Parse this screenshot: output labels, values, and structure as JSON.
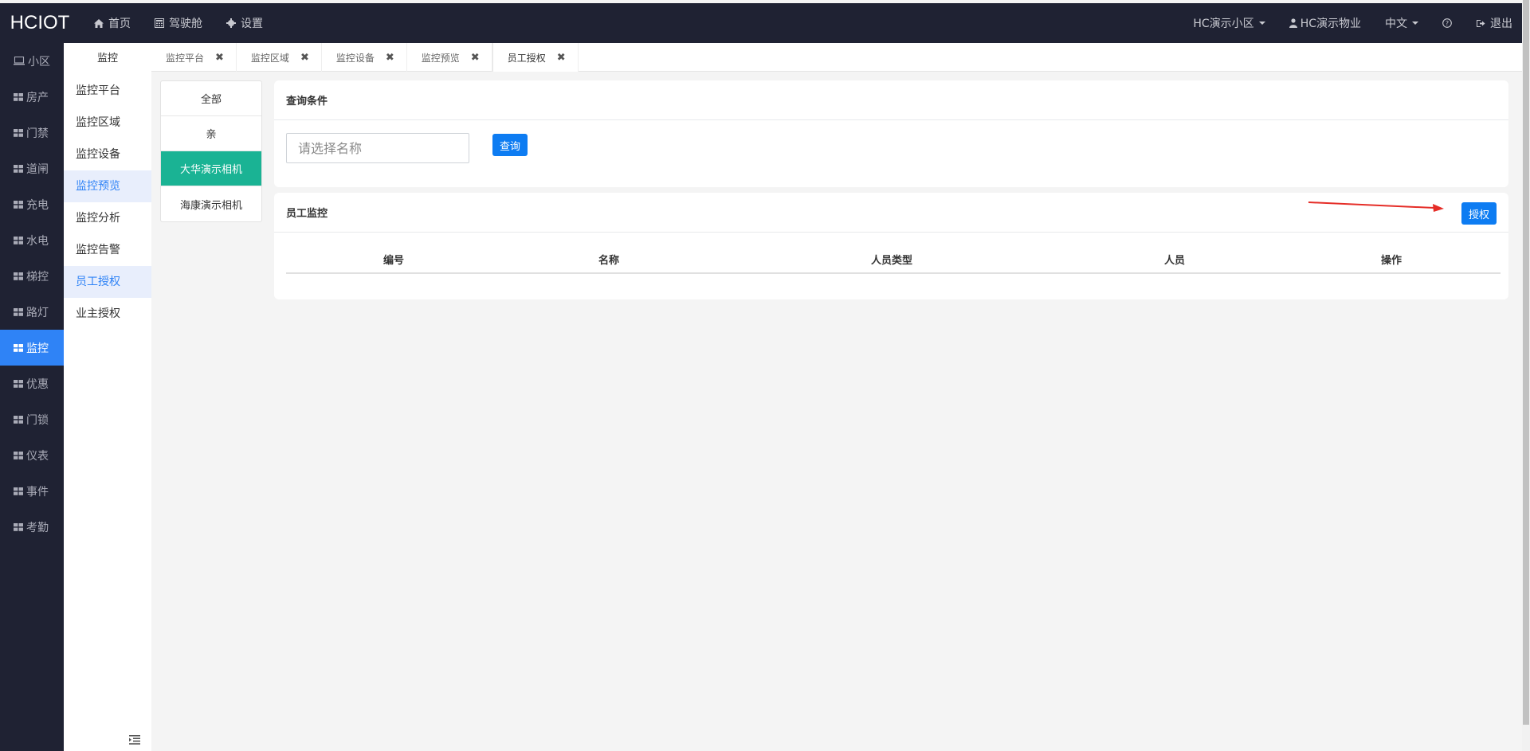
{
  "app": {
    "logo": "HCIOT"
  },
  "topnav": [
    {
      "label": "首页",
      "icon": "home-icon"
    },
    {
      "label": "驾驶舱",
      "icon": "calculator-icon"
    },
    {
      "label": "设置",
      "icon": "gear-icon"
    }
  ],
  "topright": {
    "community": "HC演示小区",
    "property": "HC演示物业",
    "language": "中文",
    "logout": "退出"
  },
  "sidebar": [
    {
      "label": "小区",
      "icon": "monitor-icon"
    },
    {
      "label": "房产",
      "icon": "grid-icon"
    },
    {
      "label": "门禁",
      "icon": "grid-icon"
    },
    {
      "label": "道闸",
      "icon": "grid-icon"
    },
    {
      "label": "充电",
      "icon": "grid-icon"
    },
    {
      "label": "水电",
      "icon": "grid-icon"
    },
    {
      "label": "梯控",
      "icon": "grid-icon"
    },
    {
      "label": "路灯",
      "icon": "grid-icon"
    },
    {
      "label": "监控",
      "icon": "grid-icon",
      "active": true
    },
    {
      "label": "优惠",
      "icon": "grid-icon"
    },
    {
      "label": "门锁",
      "icon": "grid-icon"
    },
    {
      "label": "仪表",
      "icon": "grid-icon"
    },
    {
      "label": "事件",
      "icon": "grid-icon"
    },
    {
      "label": "考勤",
      "icon": "grid-icon"
    }
  ],
  "submenu": {
    "title": "监控",
    "items": [
      "监控平台",
      "监控区域",
      "监控设备",
      "监控预览",
      "监控分析",
      "监控告警",
      "员工授权",
      "业主授权"
    ]
  },
  "tabs": [
    "监控平台",
    "监控区域",
    "监控设备",
    "监控预览",
    "员工授权"
  ],
  "cameras": [
    "全部",
    "亲",
    "大华演示相机",
    "海康演示相机"
  ],
  "query": {
    "title": "查询条件",
    "placeholder": "请选择名称",
    "button": "查询"
  },
  "staff": {
    "title": "员工监控",
    "auth_button": "授权",
    "columns": [
      "编号",
      "名称",
      "人员类型",
      "人员",
      "操作"
    ]
  },
  "colors": {
    "accent": "#0d7cf2",
    "active_camera": "#1ab394",
    "sidebar_bg": "#1f2233",
    "sidebar_active": "#2f83f6"
  }
}
